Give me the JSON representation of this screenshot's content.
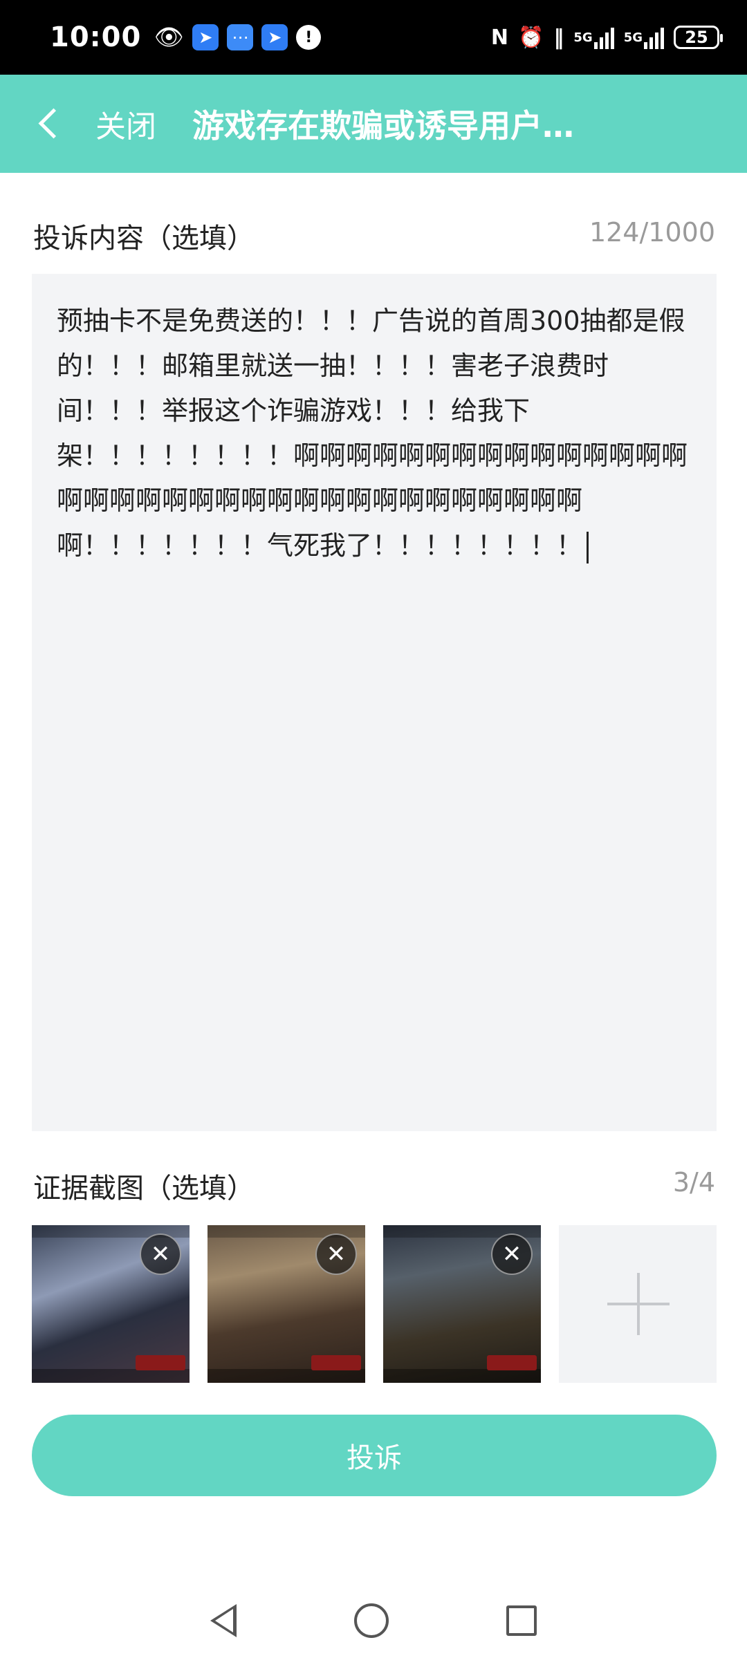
{
  "status_bar": {
    "time": "10:00",
    "left_icons": [
      "eye-icon",
      "app-icon",
      "message-icon",
      "app-icon",
      "circle-app-icon"
    ],
    "right_icons": [
      "nfc-icon",
      "alarm-icon",
      "vibrate-icon",
      "signal-5g-icon",
      "signal-5g-icon"
    ],
    "network_label": "5G",
    "battery": "25"
  },
  "header": {
    "close_label": "关闭",
    "title": "游戏存在欺骗或诱导用户…"
  },
  "complaint": {
    "label": "投诉内容（选填）",
    "count": "124/1000",
    "text": "预抽卡不是免费送的！！！广告说的首周300抽都是假的！！！邮箱里就送一抽！！！！害老子浪费时间！！！举报这个诈骗游戏！！！给我下架！！！！！！！！啊啊啊啊啊啊啊啊啊啊啊啊啊啊啊啊啊啊啊啊啊啊啊啊啊啊啊啊啊啊啊啊啊啊啊啊！！！！！！！气死我了！！！！！！！！"
  },
  "evidence": {
    "label": "证据截图（选填）",
    "count": "3/4",
    "close_symbol": "✕"
  },
  "submit_label": "投诉",
  "colors": {
    "accent": "#62d6c3",
    "input_bg": "#f3f4f6",
    "muted_text": "#9a9a9a"
  }
}
